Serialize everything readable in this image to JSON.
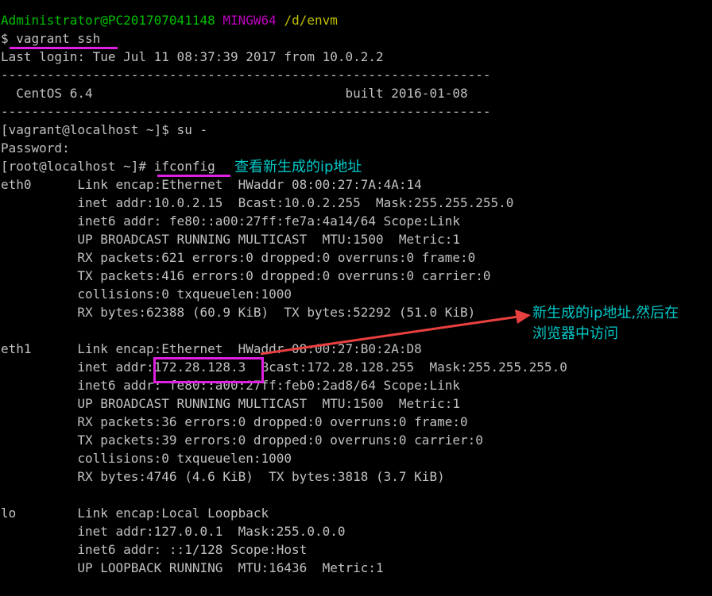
{
  "prompt": {
    "user_host": "Administrator@PC201707041148",
    "shell": "MINGW64",
    "path": "/d/envm"
  },
  "lines": [
    "$ vagrant ssh",
    "Last login: Tue Jul 11 08:37:39 2017 from 10.0.2.2",
    "----------------------------------------------------------------",
    "  CentOS 6.4                                 built 2016-01-08",
    "----------------------------------------------------------------",
    "[vagrant@localhost ~]$ su -",
    "Password:",
    "[root@localhost ~]# ifconfig",
    "eth0      Link encap:Ethernet  HWaddr 08:00:27:7A:4A:14",
    "          inet addr:10.0.2.15  Bcast:10.0.2.255  Mask:255.255.255.0",
    "          inet6 addr: fe80::a00:27ff:fe7a:4a14/64 Scope:Link",
    "          UP BROADCAST RUNNING MULTICAST  MTU:1500  Metric:1",
    "          RX packets:621 errors:0 dropped:0 overruns:0 frame:0",
    "          TX packets:416 errors:0 dropped:0 overruns:0 carrier:0",
    "          collisions:0 txqueuelen:1000",
    "          RX bytes:62388 (60.9 KiB)  TX bytes:52292 (51.0 KiB)",
    "",
    "eth1      Link encap:Ethernet  HWaddr 08:00:27:B0:2A:D8",
    "          inet addr:172.28.128.3  Bcast:172.28.128.255  Mask:255.255.255.0",
    "          inet6 addr: fe80::a00:27ff:feb0:2ad8/64 Scope:Link",
    "          UP BROADCAST RUNNING MULTICAST  MTU:1500  Metric:1",
    "          RX packets:36 errors:0 dropped:0 overruns:0 frame:0",
    "          TX packets:39 errors:0 dropped:0 overruns:0 carrier:0",
    "          collisions:0 txqueuelen:1000",
    "          RX bytes:4746 (4.6 KiB)  TX bytes:3818 (3.7 KiB)",
    "",
    "lo        Link encap:Local Loopback",
    "          inet addr:127.0.0.1  Mask:255.0.0.0",
    "          inet6 addr: ::1/128 Scope:Host",
    "          UP LOOPBACK RUNNING  MTU:16436  Metric:1"
  ],
  "annotations": {
    "ifconfig_note": "查看新生成的ip地址",
    "ip_note_line1": "新生成的ip地址,然后在",
    "ip_note_line2": "浏览器中访问"
  },
  "colors": {
    "background": "#000000",
    "text": "#c0c0c0",
    "prompt_user": "#00c000",
    "prompt_shell": "#c000c0",
    "prompt_path": "#c0c000",
    "annotation": "#00c8c8",
    "highlight": "#e020e0",
    "arrow": "#e84040"
  }
}
